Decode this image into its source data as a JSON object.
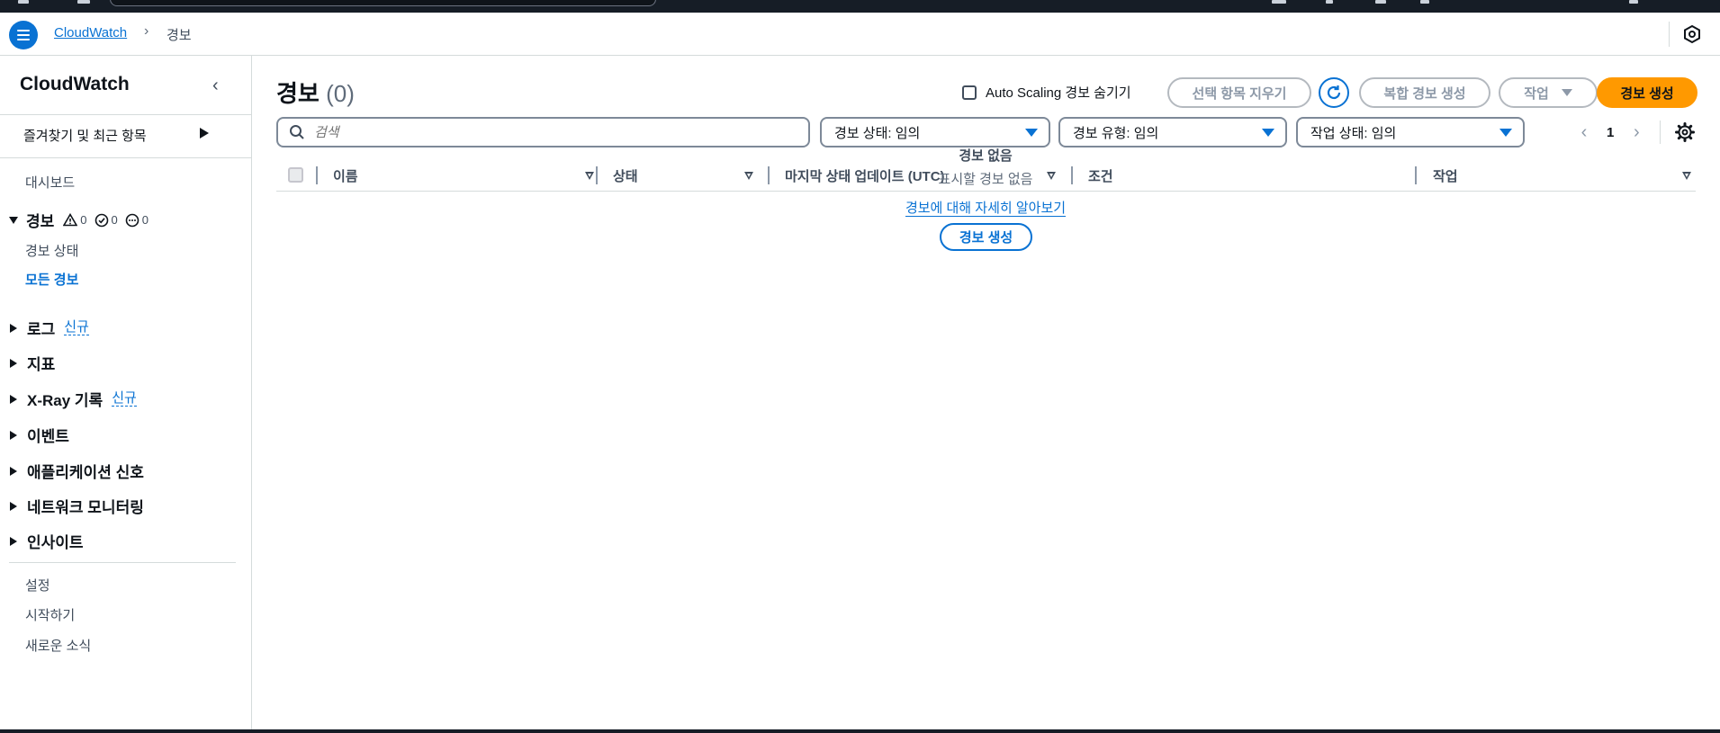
{
  "breadcrumb": {
    "root": "CloudWatch",
    "current": "경보"
  },
  "sidebar": {
    "title": "CloudWatch",
    "favorites": "즐겨찾기 및 최근 항목",
    "dashboard": "대시보드",
    "alarms": {
      "label": "경보",
      "counts": {
        "alarm": "0",
        "ok": "0",
        "insufficient": "0"
      },
      "items": [
        "경보 상태",
        "모든 경보"
      ]
    },
    "sections": [
      {
        "label": "로그",
        "badge": "신규"
      },
      {
        "label": "지표",
        "badge": ""
      },
      {
        "label": "X-Ray 기록",
        "badge": "신규"
      },
      {
        "label": "이벤트",
        "badge": ""
      },
      {
        "label": "애플리케이션 신호",
        "badge": ""
      },
      {
        "label": "네트워크 모니터링",
        "badge": ""
      },
      {
        "label": "인사이트",
        "badge": ""
      }
    ],
    "footer": [
      "설정",
      "시작하기",
      "새로운 소식"
    ]
  },
  "main": {
    "title": "경보",
    "count": "(0)",
    "hide_autoscaling": "Auto Scaling 경보 숨기기",
    "clear_selection": "선택 항목 지우기",
    "create_composite": "복합 경보 생성",
    "actions": "작업",
    "create_alarm": "경보 생성",
    "search_placeholder": "검색",
    "filters": {
      "state": "경보 상태: 임의",
      "type": "경보 유형: 임의",
      "action_state": "작업 상태: 임의"
    },
    "page": "1",
    "columns": [
      "이름",
      "상태",
      "마지막 상태 업데이트 (UTC)",
      "조건",
      "작업"
    ],
    "empty": {
      "title": "경보 없음",
      "subtitle": "표시할 경보 없음",
      "learn_more": "경보에 대해 자세히 알아보기",
      "create": "경보 생성"
    }
  },
  "colors": {
    "accent": "#0972d3",
    "primary_button": "#ff9900",
    "topbar": "#161d26"
  }
}
